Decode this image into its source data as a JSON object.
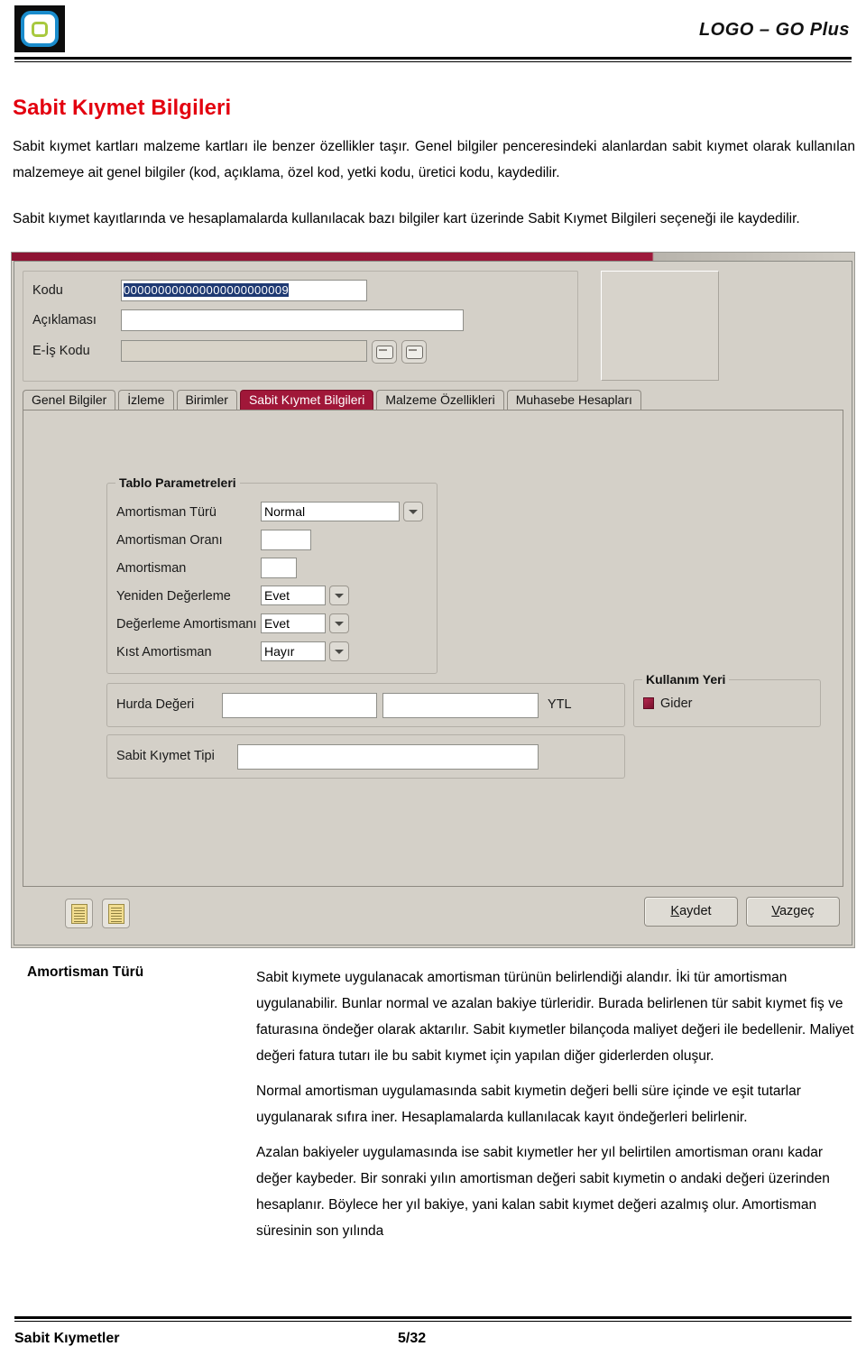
{
  "header": {
    "brand": "LOGO – GO Plus",
    "logo_icon": "logo-rounded-square-icon"
  },
  "document": {
    "title": "Sabit Kıymet Bilgileri",
    "paragraphs": [
      "Sabit kıymet kartları malzeme kartları ile benzer özellikler taşır. Genel bilgiler penceresindeki alanlardan sabit kıymet olarak kullanılan malzemeye ait genel bilgiler (kod, açıklama, özel kod, yetki kodu, üretici kodu, kaydedilir.",
      "Sabit kıymet kayıtlarında ve hesaplamalarda kullanılacak bazı bilgiler kart üzerinde Sabit Kıymet Bilgileri seçeneği ile kaydedilir."
    ]
  },
  "dialog": {
    "header_fields": [
      {
        "label": "Kodu",
        "value": "000000000000000000000009",
        "selected": true,
        "readonly": false
      },
      {
        "label": "Açıklaması",
        "value": "",
        "selected": false,
        "readonly": false
      },
      {
        "label": "E-İş Kodu",
        "value": "",
        "selected": false,
        "readonly": true
      }
    ],
    "header_icon_buttons": [
      {
        "name": "e-is-lookup-icon",
        "glyph": "card-icon"
      },
      {
        "name": "e-is-detail-icon",
        "glyph": "card-list-icon"
      }
    ],
    "photo_placeholder": "image-placeholder",
    "tabs": [
      {
        "label": "Genel Bilgiler",
        "active": false
      },
      {
        "label": "İzleme",
        "active": false
      },
      {
        "label": "Birimler",
        "active": false
      },
      {
        "label": "Sabit Kıymet Bilgileri",
        "active": true
      },
      {
        "label": "Malzeme Özellikleri",
        "active": false
      },
      {
        "label": "Muhasebe Hesapları",
        "active": false
      }
    ],
    "table_params": {
      "title": "Tablo Parametreleri",
      "rows": [
        {
          "label": "Amortisman Türü",
          "value": "Normal",
          "control": "combo"
        },
        {
          "label": "Amortisman Oranı",
          "value": "",
          "control": "text"
        },
        {
          "label": "Amortisman",
          "value": "",
          "control": "text-small"
        },
        {
          "label": "Yeniden Değerleme",
          "value": "Evet",
          "control": "combo"
        },
        {
          "label": "Değerleme Amortismanı",
          "value": "Evet",
          "control": "combo"
        },
        {
          "label": "Kıst Amortisman",
          "value": "Hayır",
          "control": "combo"
        }
      ]
    },
    "hurda": {
      "label": "Hurda Değeri",
      "value1": "",
      "value2": "",
      "currency": "YTL"
    },
    "sabit_kiymet_tipi": {
      "label": "Sabit Kıymet Tipi",
      "value": ""
    },
    "kullanim_yeri": {
      "title": "Kullanım Yeri",
      "option": "Gider"
    },
    "buttons": {
      "save": "Kaydet",
      "save_accel": "K",
      "cancel": "Vazgeç",
      "cancel_accel": "V"
    },
    "note_icons": [
      "note-icon-1",
      "note-icon-2"
    ],
    "colors": {
      "titlebar": "#9d1a3b",
      "active_tab": "#a01739",
      "face": "#d4d0c8",
      "selection": "#1f3a73"
    }
  },
  "description": {
    "term": "Amortisman Türü",
    "paragraphs": [
      "Sabit kıymete uygulanacak amortisman türünün belirlendiği alandır. İki tür amortisman uygulanabilir. Bunlar normal ve azalan bakiye türleridir. Burada belirlenen tür sabit kıymet fiş ve faturasına öndeğer olarak aktarılır. Sabit kıymetler bilançoda maliyet değeri ile bedellenir. Maliyet değeri fatura tutarı ile bu sabit kıymet için yapılan diğer giderlerden oluşur.",
      "Normal amortisman uygulamasında sabit kıymetin değeri belli süre içinde ve eşit tutarlar uygulanarak sıfıra iner. Hesaplamalarda kullanılacak kayıt öndeğerleri belirlenir.",
      "Azalan bakiyeler uygulamasında ise sabit kıymetler her yıl belirtilen amortisman oranı kadar değer kaybeder. Bir sonraki yılın amortisman değeri sabit kıymetin o andaki değeri üzerinden hesaplanır. Böylece her yıl bakiye, yani kalan sabit kıymet değeri azalmış olur. Amortisman süresinin son yılında"
    ]
  },
  "footer": {
    "left": "Sabit Kıymetler",
    "page": "5/32"
  }
}
